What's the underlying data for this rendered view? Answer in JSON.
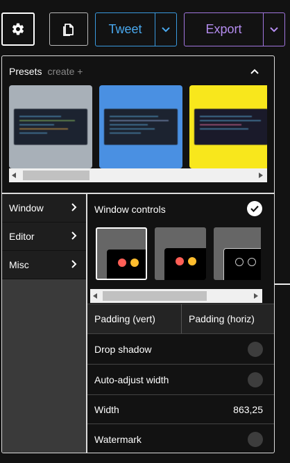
{
  "toolbar": {
    "settings_icon": "gear-icon",
    "copy_icon": "document-copy-icon",
    "tweet_label": "Tweet",
    "export_label": "Export",
    "colors": {
      "tweet": "#49a8ee",
      "export": "#b48cf0"
    }
  },
  "presets": {
    "title": "Presets",
    "create_label": "create +",
    "collapse_icon": "chevron-up-icon",
    "items": [
      {
        "background": "#a8b0b8"
      },
      {
        "background": "#4a90e2"
      },
      {
        "background": "#f8e71c"
      }
    ]
  },
  "menu": {
    "items": [
      {
        "label": "Window"
      },
      {
        "label": "Editor"
      },
      {
        "label": "Misc"
      }
    ]
  },
  "window_controls": {
    "title": "Window controls",
    "checked": true,
    "options": [
      {
        "style": "mac-color",
        "selected": true
      },
      {
        "style": "mac-color",
        "selected": false
      },
      {
        "style": "mac-outline",
        "selected": false
      }
    ]
  },
  "settings": {
    "padding_vert_label": "Padding (vert)",
    "padding_horiz_label": "Padding (horiz)",
    "drop_shadow_label": "Drop shadow",
    "auto_adjust_label": "Auto-adjust width",
    "width_label": "Width",
    "width_value": "863,25",
    "watermark_label": "Watermark"
  }
}
